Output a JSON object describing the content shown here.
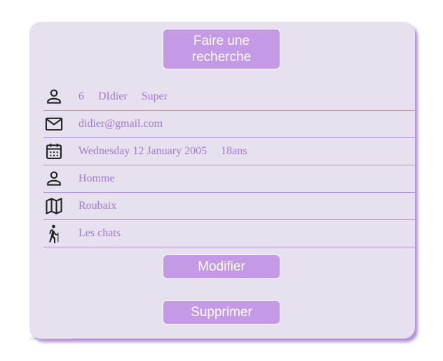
{
  "buttons": {
    "search_label": "Faire une recherche",
    "edit_label": "Modifier",
    "delete_label": "Supprimer"
  },
  "profile": {
    "id": "6",
    "firstname": "DIdier",
    "lastname": "Super",
    "email": "didier@gmail.com",
    "birthdate": "Wednesday 12 January 2005",
    "age": "18ans",
    "gender": "Homme",
    "city": "Roubaix",
    "hobby": "Les chats"
  },
  "icons": [
    "person-icon",
    "mail-icon",
    "calendar-icon",
    "gender-icon",
    "map-icon",
    "hiking-icon"
  ],
  "colors": {
    "card": "#e7e0ef",
    "button": "#c49ae6",
    "text": "#a07ccb",
    "divider": "#b18fd4"
  }
}
